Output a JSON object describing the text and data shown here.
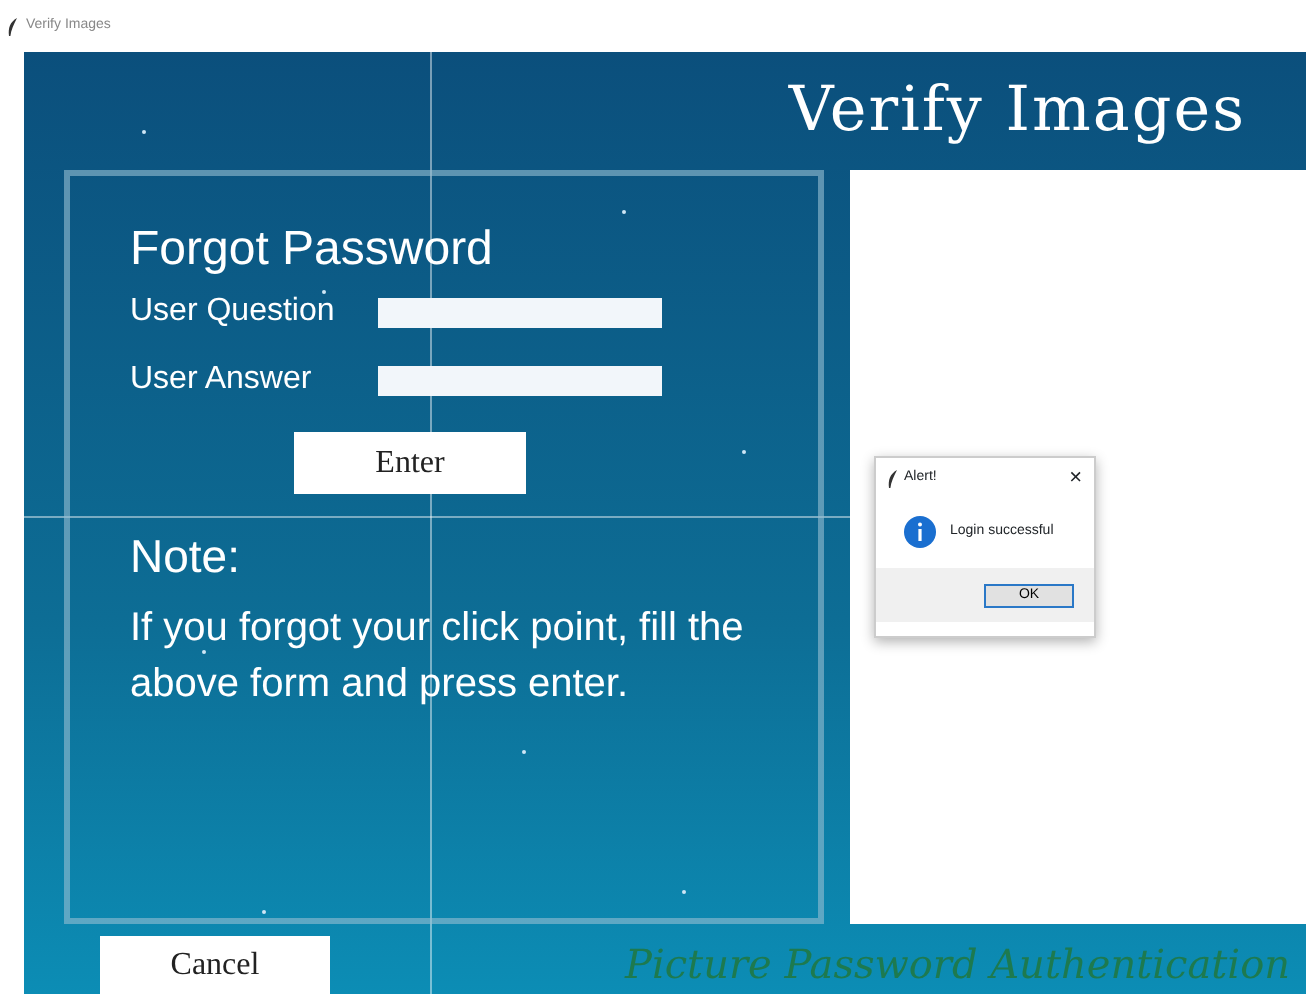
{
  "window": {
    "title": "Verify Images"
  },
  "header": {
    "title": "Verify Images"
  },
  "form": {
    "title": "Forgot Password",
    "fields": [
      {
        "label": "User Question"
      },
      {
        "label": "User Answer"
      }
    ],
    "enter_button": "Enter"
  },
  "note": {
    "heading": "Note:",
    "text": "If you forgot your click point, fill the above form and press enter."
  },
  "alert": {
    "title": "Alert!",
    "close": "×",
    "message": "Login successful",
    "ok_button": "OK"
  },
  "cancel_button": "Cancel",
  "footer": "Picture Password Authentication"
}
